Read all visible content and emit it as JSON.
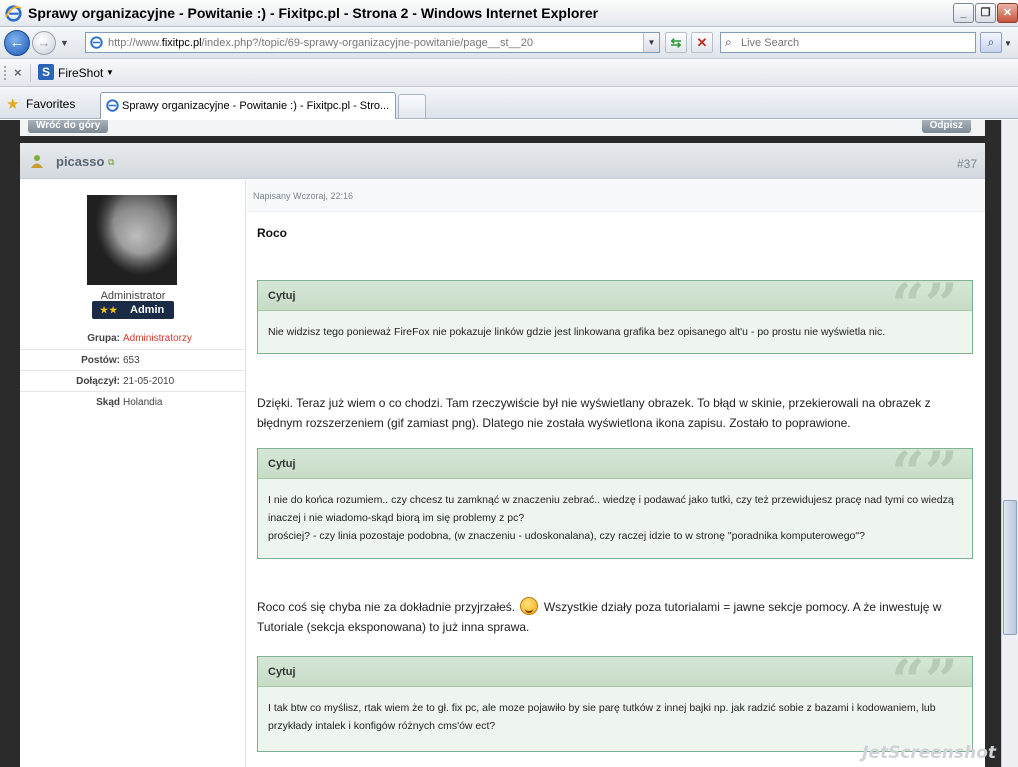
{
  "window": {
    "title": "Sprawy organizacyjne - Powitanie :) - Fixitpc.pl - Strona 2 - Windows Internet Explorer",
    "minimize": "_",
    "maximize": "❐",
    "close": "✕"
  },
  "address_bar": {
    "url_prefix": "http://www.",
    "url_domain": "fixitpc.pl",
    "url_rest": "/index.php?/topic/69-sprawy-organizacyjne-powitanie/page__st__20"
  },
  "search": {
    "placeholder": "Live Search"
  },
  "toolbar": {
    "fireshot_label": "FireShot"
  },
  "favorites": {
    "label": "Favorites"
  },
  "tab": {
    "title": "Sprawy organizacyjne - Powitanie :) - Fixitpc.pl - Stro..."
  },
  "page": {
    "back_to_top": "Wróć do góry",
    "reply": "Odpisz",
    "post": {
      "username": "picasso",
      "number": "#37",
      "date": "Napisany Wczoraj, 22:16",
      "user": {
        "title": "Administrator",
        "badge": "Admin",
        "badge_stars": "★★",
        "info": [
          {
            "label": "Grupa:",
            "value": "Administratorzy"
          },
          {
            "label": "Postów:",
            "value": "653"
          },
          {
            "label": "Dołączył:",
            "value": "21-05-2010"
          },
          {
            "label": "Skąd",
            "value": "Holandia"
          }
        ]
      },
      "intro": "Roco",
      "quote_label": "Cytuj",
      "quotes": [
        "Nie widzisz tego ponieważ FireFox nie pokazuje linków gdzie jest linkowana grafika bez opisanego alt'u - po prostu nie wyświetla nic.",
        "I nie do końca rozumiem.. czy chcesz tu zamknąć w znaczeniu zebrać.. wiedzę i podawać jako tutki, czy też przewidujesz pracę nad tymi co wiedzą inaczej i nie wiadomo-skąd biorą im się problemy z pc?",
        "I tak btw co myślisz, rtak wiem że to gł. fix pc, ale moze pojawiło by sie parę tutków z innej bajki np. jak radzić sobie z bazami i kodowaniem, lub przykłady intalek i konfigów różnych cms'ów ect?"
      ],
      "quote2_line2": "prościej? - czy linia pozostaje podobna, (w znaczeniu - udoskonalana), czy raczej idzie to w stronę \"poradnika komputerowego\"?",
      "reply1": "Dzięki. Teraz już wiem o co chodzi. Tam rzeczywiście był nie wyświetlany obrazek. To błąd w skinie, przekierowali na obrazek z błędnym rozszerzeniem (gif zamiast png). Dlatego nie została wyświetlona ikona zapisu. Zostało to poprawione.",
      "reply2_a": "Roco coś się chyba nie za dokładnie przyjrzałeś.",
      "reply2_b": "Wszystkie działy poza tutorialami = jawne sekcje pomocy. A że inwestuję w Tutoriale (sekcja eksponowana) to już inna sprawa."
    }
  },
  "watermark": "JetScreenshot",
  "colors": {
    "quote_border": "#7fb08f",
    "quote_bg": "#eef4ee",
    "badge_bg": "#1a2b46",
    "group_red": "#d43b2a"
  }
}
